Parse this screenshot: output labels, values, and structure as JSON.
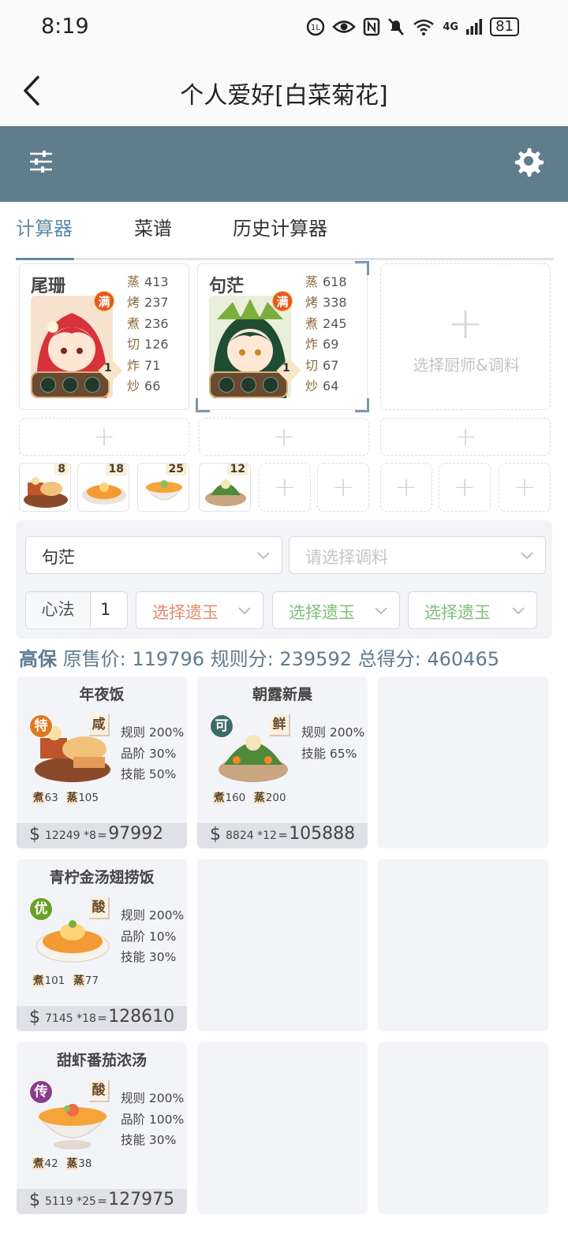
{
  "status_bar": {
    "time": "8:19",
    "net": "4G",
    "battery": "81"
  },
  "header": {
    "title": "个人爱好[白菜菊花]"
  },
  "tabs": [
    {
      "label": "计算器"
    },
    {
      "label": "菜谱"
    },
    {
      "label": "历史计算器"
    }
  ],
  "chefs": [
    {
      "name": "尾珊",
      "badge": "满",
      "level": "1",
      "skills": [
        {
          "k": "蒸",
          "v": "413"
        },
        {
          "k": "烤",
          "v": "237"
        },
        {
          "k": "煮",
          "v": "236"
        },
        {
          "k": "切",
          "v": "126"
        },
        {
          "k": "炸",
          "v": "71"
        },
        {
          "k": "炒",
          "v": "66"
        }
      ]
    },
    {
      "name": "句茫",
      "badge": "满",
      "level": "1",
      "skills": [
        {
          "k": "蒸",
          "v": "618"
        },
        {
          "k": "烤",
          "v": "338"
        },
        {
          "k": "煮",
          "v": "245"
        },
        {
          "k": "炸",
          "v": "69"
        },
        {
          "k": "切",
          "v": "67"
        },
        {
          "k": "炒",
          "v": "64"
        }
      ]
    }
  ],
  "empty_chef_label": "选择厨师&调料",
  "dish_counts": [
    "8",
    "18",
    "25",
    "12"
  ],
  "panel": {
    "chef_select": "句茫",
    "seasoning_placeholder": "请选择调料",
    "xinfa_label": "心法",
    "xinfa_value": "1",
    "jade_label": "选择遗玉"
  },
  "summary": {
    "tier": "高保",
    "price_label": "原售价:",
    "price": "119796",
    "rule_label": "规则分:",
    "rule": "239592",
    "total_label": "总得分:",
    "total": "460465"
  },
  "dishes": [
    {
      "name": "年夜饭",
      "rarity": "特",
      "rarity_color": "#e07a1f",
      "flavor": "咸",
      "stats": [
        "规则 200%",
        "品阶 30%",
        "技能 50%"
      ],
      "skills": [
        {
          "k": "煮",
          "v": "63"
        },
        {
          "k": "蒸",
          "v": "105"
        }
      ],
      "price": "12249",
      "mult": "*8",
      "eq": "=",
      "total": "97992"
    },
    {
      "name": "朝露新晨",
      "rarity": "可",
      "rarity_color": "#3d6b6b",
      "flavor": "鲜",
      "stats": [
        "规则 200%",
        "技能 65%"
      ],
      "skills": [
        {
          "k": "煮",
          "v": "160"
        },
        {
          "k": "蒸",
          "v": "200"
        }
      ],
      "price": "8824",
      "mult": "*12",
      "eq": "=",
      "total": "105888"
    },
    {
      "name": "青柠金汤翅捞饭",
      "rarity": "优",
      "rarity_color": "#6aa12a",
      "flavor": "酸",
      "stats": [
        "规则 200%",
        "品阶 10%",
        "技能 30%"
      ],
      "skills": [
        {
          "k": "煮",
          "v": "101"
        },
        {
          "k": "蒸",
          "v": "77"
        }
      ],
      "price": "7145",
      "mult": "*18",
      "eq": "=",
      "total": "128610"
    },
    {
      "name": "甜虾番茄浓汤",
      "rarity": "传",
      "rarity_color": "#8a3d8f",
      "flavor": "酸",
      "stats": [
        "规则 200%",
        "品阶 100%",
        "技能 30%"
      ],
      "skills": [
        {
          "k": "煮",
          "v": "42"
        },
        {
          "k": "蒸",
          "v": "38"
        }
      ],
      "price": "5119",
      "mult": "*25",
      "eq": "=",
      "total": "127975"
    }
  ],
  "icons": {
    "back": "back-arrow-icon",
    "filter": "filter-sliders-icon",
    "settings": "gear-icon",
    "currency": "$"
  },
  "colors": {
    "toolbar": "#607d8b",
    "accent": "#5f8aa8",
    "summary_text": "#5f7b90",
    "seasoning": "#e08c6c",
    "jade": "#7fbf7a"
  }
}
